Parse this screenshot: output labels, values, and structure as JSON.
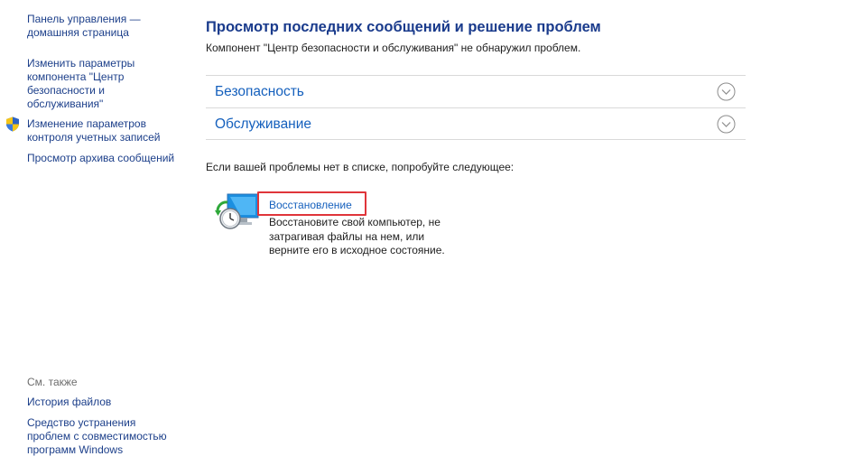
{
  "sidebar": {
    "links": [
      "Панель управления — домашняя страница",
      "Изменить параметры компонента \"Центр безопасности и обслуживания\"",
      "Изменение параметров контроля учетных записей",
      "Просмотр архива сообщений"
    ],
    "see_also_title": "См. также",
    "see_also_links": [
      "История файлов",
      "Средство устранения проблем с совместимостью программ Windows"
    ]
  },
  "main": {
    "title": "Просмотр последних сообщений и решение проблем",
    "status": "Компонент \"Центр безопасности и обслуживания\" не обнаружил проблем.",
    "sections": [
      "Безопасность",
      "Обслуживание"
    ],
    "suggest": "Если вашей проблемы нет в списке, попробуйте следующее:",
    "recovery": {
      "link": "Восстановление",
      "description": "Восстановите свой компьютер, не затрагивая файлы на нем, или верните его в исходное состояние."
    }
  },
  "icons": {
    "shield": "uac-shield-icon",
    "recovery": "recovery-monitor-clock-icon",
    "expand": "chevron-down-circle-icon"
  },
  "colors": {
    "link": "#1c3f8a",
    "section_header": "#1560bd",
    "highlight_box": "#e0353a",
    "divider": "#d9d9d9"
  }
}
